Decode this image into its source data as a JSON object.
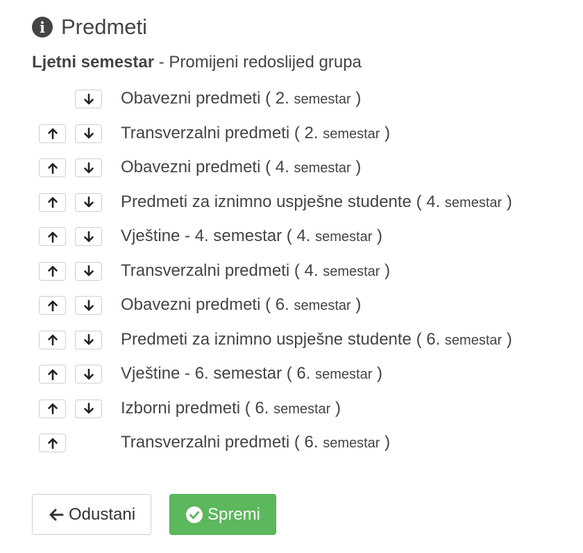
{
  "page": {
    "title": "Predmeti",
    "title_icon": "info-circle-icon"
  },
  "subtitle": {
    "semester": "Ljetni semestar",
    "action": " - Promijeni redoslijed grupa"
  },
  "groups": [
    {
      "name": "Obavezni predmeti",
      "semester_num": "2.",
      "semester_word": "semestar",
      "can_move_up": false,
      "can_move_down": true
    },
    {
      "name": "Transverzalni predmeti",
      "semester_num": "2.",
      "semester_word": "semestar",
      "can_move_up": true,
      "can_move_down": true
    },
    {
      "name": "Obavezni predmeti",
      "semester_num": "4.",
      "semester_word": "semestar",
      "can_move_up": true,
      "can_move_down": true
    },
    {
      "name": "Predmeti za iznimno uspješne studente",
      "semester_num": "4.",
      "semester_word": "semestar",
      "can_move_up": true,
      "can_move_down": true
    },
    {
      "name": "Vještine - 4. semestar",
      "semester_num": "4.",
      "semester_word": "semestar",
      "can_move_up": true,
      "can_move_down": true
    },
    {
      "name": "Transverzalni predmeti",
      "semester_num": "4.",
      "semester_word": "semestar",
      "can_move_up": true,
      "can_move_down": true
    },
    {
      "name": "Obavezni predmeti",
      "semester_num": "6.",
      "semester_word": "semestar",
      "can_move_up": true,
      "can_move_down": true
    },
    {
      "name": "Predmeti za iznimno uspješne studente",
      "semester_num": "6.",
      "semester_word": "semestar",
      "can_move_up": true,
      "can_move_down": true
    },
    {
      "name": "Vještine - 6. semestar",
      "semester_num": "6.",
      "semester_word": "semestar",
      "can_move_up": true,
      "can_move_down": true
    },
    {
      "name": "Izborni predmeti",
      "semester_num": "6.",
      "semester_word": "semestar",
      "can_move_up": true,
      "can_move_down": true
    },
    {
      "name": "Transverzalni predmeti",
      "semester_num": "6.",
      "semester_word": "semestar",
      "can_move_up": true,
      "can_move_down": false
    }
  ],
  "buttons": {
    "cancel_label": "Odustani",
    "cancel_icon": "arrow-left-icon",
    "save_label": "Spremi",
    "save_icon": "check-circle-icon",
    "save_color": "#5cb85c"
  },
  "icons": {
    "move_up": "arrow-up-icon",
    "move_down": "arrow-down-icon"
  }
}
